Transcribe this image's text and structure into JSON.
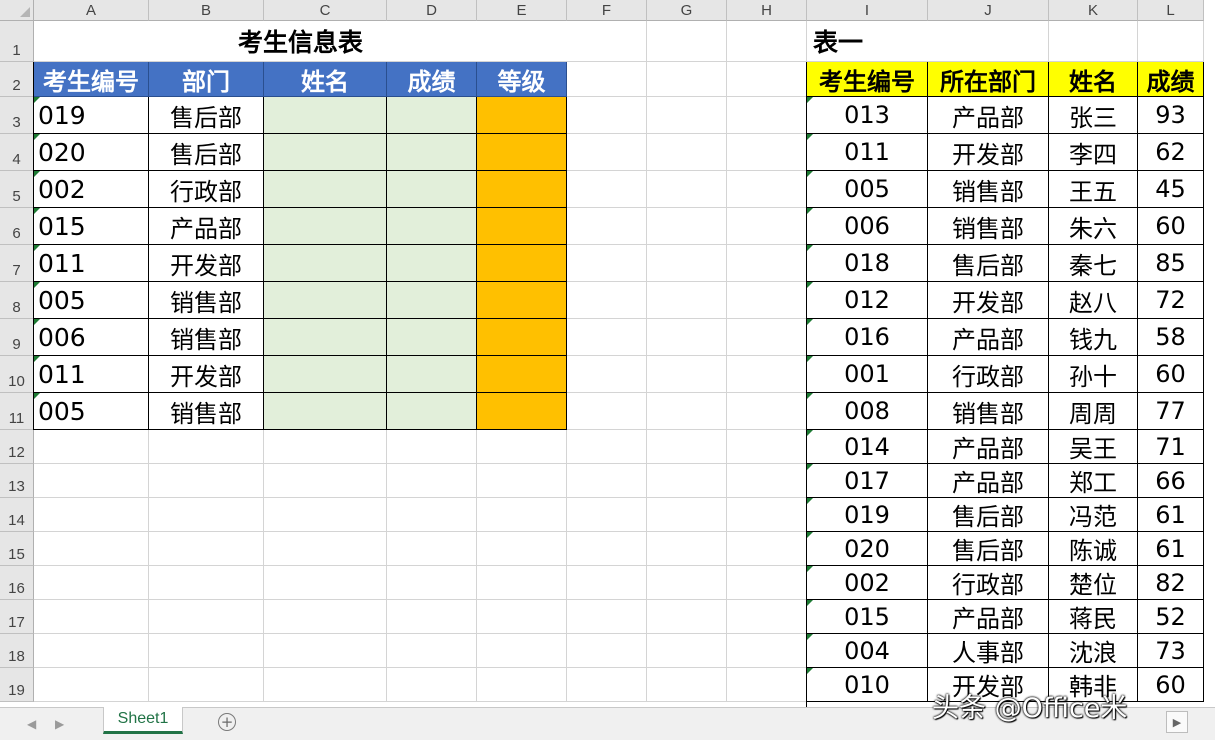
{
  "columns": [
    "A",
    "B",
    "C",
    "D",
    "E",
    "F",
    "G",
    "H",
    "I",
    "J",
    "K",
    "L"
  ],
  "rows": [
    "1",
    "2",
    "3",
    "4",
    "5",
    "6",
    "7",
    "8",
    "9",
    "10",
    "11",
    "12",
    "13",
    "14",
    "15",
    "16",
    "17",
    "18",
    "19"
  ],
  "table1": {
    "title": "考生信息表",
    "headers": [
      "考生编号",
      "部门",
      "姓名",
      "成绩",
      "等级"
    ],
    "rows": [
      {
        "id": "019",
        "dept": "售后部"
      },
      {
        "id": "020",
        "dept": "售后部"
      },
      {
        "id": "002",
        "dept": "行政部"
      },
      {
        "id": "015",
        "dept": "产品部"
      },
      {
        "id": "011",
        "dept": "开发部"
      },
      {
        "id": "005",
        "dept": "销售部"
      },
      {
        "id": "006",
        "dept": "销售部"
      },
      {
        "id": "011",
        "dept": "开发部"
      },
      {
        "id": "005",
        "dept": "销售部"
      }
    ],
    "header_color": "#4472c4",
    "input_fill_color": "#e2efda",
    "grade_fill_color": "#ffc000"
  },
  "table2": {
    "title": "表一",
    "headers": [
      "考生编号",
      "所在部门",
      "姓名",
      "成绩"
    ],
    "rows": [
      {
        "id": "013",
        "dept": "产品部",
        "name": "张三",
        "score": "93"
      },
      {
        "id": "011",
        "dept": "开发部",
        "name": "李四",
        "score": "62"
      },
      {
        "id": "005",
        "dept": "销售部",
        "name": "王五",
        "score": "45"
      },
      {
        "id": "006",
        "dept": "销售部",
        "name": "朱六",
        "score": "60"
      },
      {
        "id": "018",
        "dept": "售后部",
        "name": "秦七",
        "score": "85"
      },
      {
        "id": "012",
        "dept": "开发部",
        "name": "赵八",
        "score": "72"
      },
      {
        "id": "016",
        "dept": "产品部",
        "name": "钱九",
        "score": "58"
      },
      {
        "id": "001",
        "dept": "行政部",
        "name": "孙十",
        "score": "60"
      },
      {
        "id": "008",
        "dept": "销售部",
        "name": "周周",
        "score": "77"
      },
      {
        "id": "014",
        "dept": "产品部",
        "name": "吴王",
        "score": "71"
      },
      {
        "id": "017",
        "dept": "产品部",
        "name": "郑工",
        "score": "66"
      },
      {
        "id": "019",
        "dept": "售后部",
        "name": "冯范",
        "score": "61"
      },
      {
        "id": "020",
        "dept": "售后部",
        "name": "陈诚",
        "score": "61"
      },
      {
        "id": "002",
        "dept": "行政部",
        "name": "楚位",
        "score": "82"
      },
      {
        "id": "015",
        "dept": "产品部",
        "name": "蒋民",
        "score": "52"
      },
      {
        "id": "004",
        "dept": "人事部",
        "name": "沈浪",
        "score": "73"
      },
      {
        "id": "010",
        "dept": "开发部",
        "name": "韩非",
        "score": "60"
      }
    ],
    "header_color": "#ffff00"
  },
  "sheet_tab": {
    "label": "Sheet1",
    "accent": "#217346"
  },
  "watermark": "头条 @Office米",
  "icons": {
    "add_sheet": "plus-circle-icon",
    "nav_prev": "triangle-left-icon",
    "nav_next": "triangle-right-icon"
  }
}
